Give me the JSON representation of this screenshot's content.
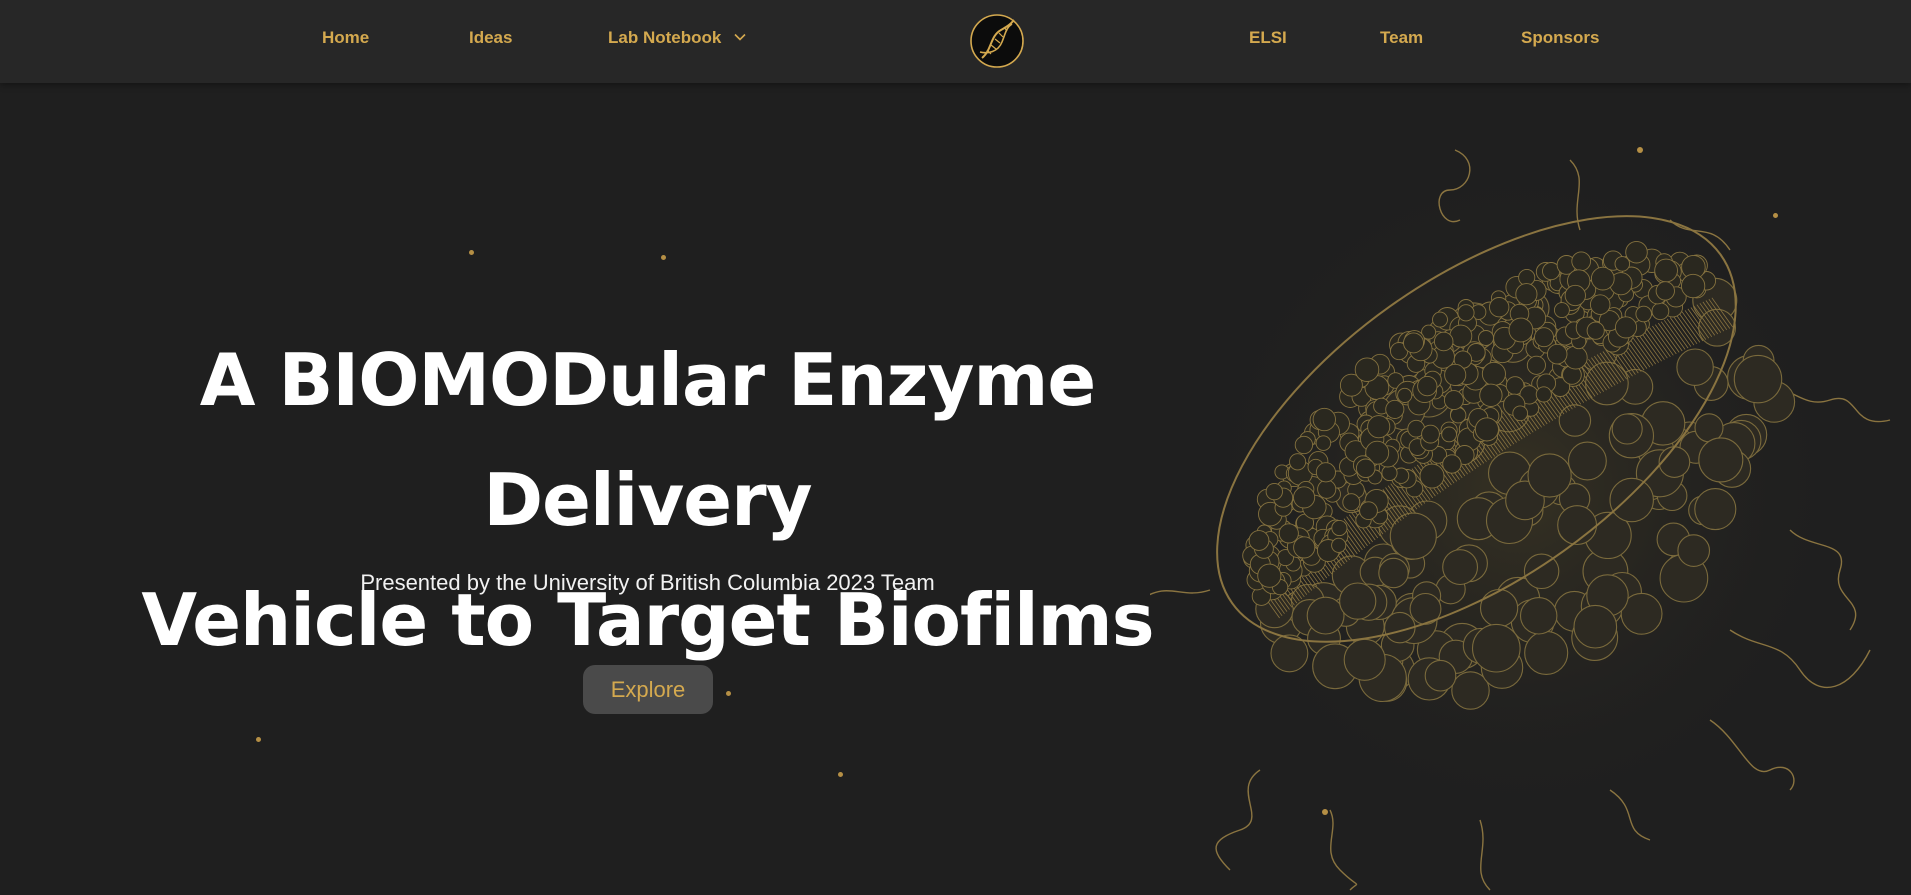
{
  "nav": {
    "home": "Home",
    "ideas": "Ideas",
    "lab_notebook": "Lab Notebook",
    "elsi": "ELSI",
    "team": "Team",
    "sponsors": "Sponsors"
  },
  "hero": {
    "title_line1": "A BIOMODular Enzyme Delivery",
    "title_line2": "Vehicle to Target Biofilms",
    "subtitle": "Presented by the University of British Columbia 2023 Team",
    "explore_label": "Explore"
  },
  "icons": {
    "logo": "dna-helix-logo-icon",
    "dropdown": "chevron-down-icon",
    "illustration": "biofilm-vehicle-illustration"
  },
  "colors": {
    "background": "#1f1f1f",
    "navbar": "#272727",
    "accent_gold": "#d4a94f",
    "title_text": "#ffffff",
    "button_bg": "#4a4a4a"
  }
}
